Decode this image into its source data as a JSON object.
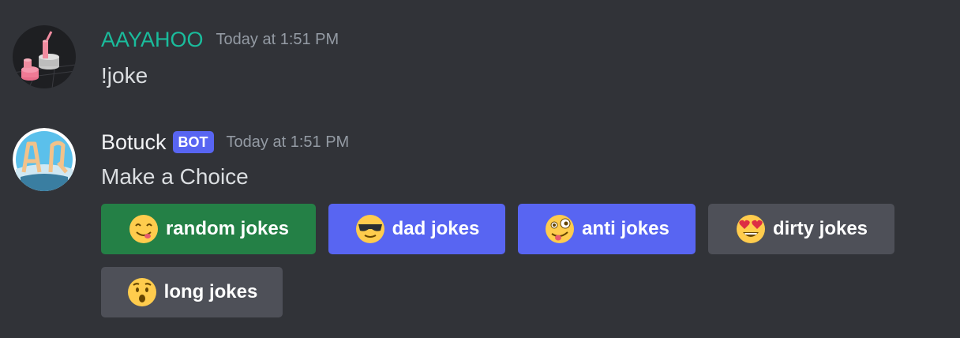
{
  "messages": [
    {
      "username": "AAYAHOO",
      "timestamp": "Today at 1:51 PM",
      "content": "!joke",
      "username_color": "#1abc9c",
      "avatar_icon": "3d-shapes-avatar-icon"
    },
    {
      "username": "Botuck",
      "bot_tag": "BOT",
      "timestamp": "Today at 1:51 PM",
      "content": "Make a Choice",
      "username_color": "#f2f3f5",
      "avatar_icon": "letters-avatar-icon"
    }
  ],
  "buttons": [
    {
      "label": "random jokes",
      "emoji": "yum-face-icon",
      "color": "#248046"
    },
    {
      "label": "dad jokes",
      "emoji": "sunglasses-face-icon",
      "color": "#5865f2"
    },
    {
      "label": "anti jokes",
      "emoji": "zany-face-icon",
      "color": "#5865f2"
    },
    {
      "label": "dirty jokes",
      "emoji": "heart-eyes-face-icon",
      "color": "#4e5058"
    },
    {
      "label": "long jokes",
      "emoji": "hushed-face-icon",
      "color": "#4e5058"
    }
  ],
  "colors": {
    "background": "#313338",
    "timestamp": "#949ba4",
    "text": "#dbdee1",
    "bot_tag": "#5865f2"
  }
}
